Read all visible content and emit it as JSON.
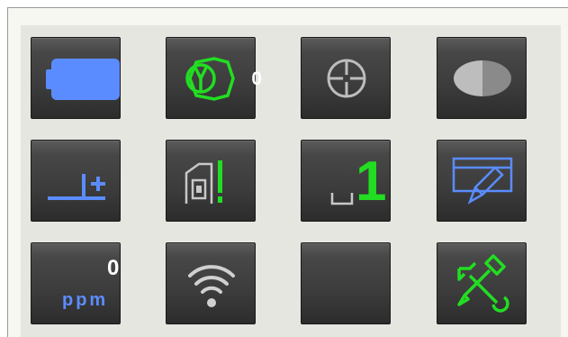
{
  "status_buttons": [
    {
      "id": "battery",
      "icon": "battery-icon",
      "color": "#5b8cff"
    },
    {
      "id": "prism-constant",
      "icon": "prism-icon",
      "value": "0",
      "color": "#22dd22"
    },
    {
      "id": "target",
      "icon": "crosshair-target-icon",
      "color": "#bdbdbd"
    },
    {
      "id": "contrast",
      "icon": "contrast-icon",
      "color": "#cfcfcf"
    },
    {
      "id": "tilt-correction",
      "icon": "tilt-compensation-icon",
      "color": "#5b8cff"
    },
    {
      "id": "edm-mode",
      "icon": "laser-measure-icon",
      "color": "#22dd22"
    },
    {
      "id": "measurement-count",
      "icon": "single-measure-icon",
      "value": "1",
      "color": "#22dd22"
    },
    {
      "id": "input-mode",
      "icon": "keyboard-pen-icon",
      "color": "#5b8cff"
    },
    {
      "id": "atmospheric-correction",
      "icon": "ppm-icon",
      "value": "0",
      "unit": "ppm",
      "color": "#5b8cff"
    },
    {
      "id": "wireless",
      "icon": "wifi-icon",
      "color": "#d0d0d0"
    },
    {
      "id": "empty",
      "icon": "",
      "color": ""
    },
    {
      "id": "settings",
      "icon": "tools-icon",
      "color": "#22dd22"
    }
  ]
}
